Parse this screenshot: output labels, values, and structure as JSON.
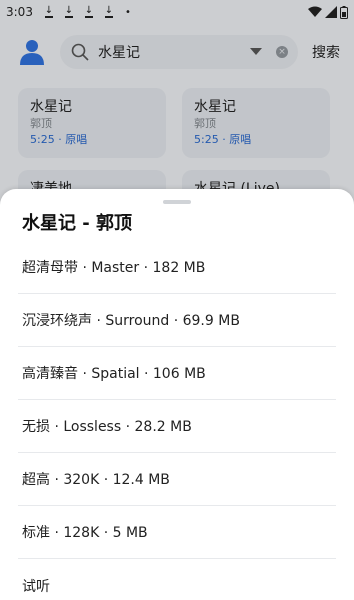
{
  "status_bar": {
    "time": "3:03",
    "download_count": 4
  },
  "header": {
    "search_value": "水星记",
    "search_button": "搜索"
  },
  "results": [
    {
      "title": "水星记",
      "artist": "郭顶",
      "duration": "5:25",
      "tag": "原唱"
    },
    {
      "title": "水星记",
      "artist": "郭顶",
      "duration": "5:25",
      "tag": "原唱"
    },
    {
      "title": "凄美地",
      "artist": "",
      "duration": "",
      "tag": ""
    },
    {
      "title": "水星记 (Live)",
      "artist": "",
      "duration": "",
      "tag": ""
    }
  ],
  "sheet": {
    "title": "水星记 - 郭顶",
    "options": [
      {
        "label": "超清母带 · Master · 182 MB"
      },
      {
        "label": "沉浸环绕声 · Surround · 69.9 MB"
      },
      {
        "label": "高清臻音 · Spatial · 106 MB"
      },
      {
        "label": "无损 · Lossless · 28.2 MB"
      },
      {
        "label": "超高 · 320K · 12.4 MB"
      },
      {
        "label": "标准 · 128K · 5 MB"
      },
      {
        "label": "试听"
      }
    ]
  },
  "colors": {
    "accent": "#2f6fd6",
    "link": "#2966c7",
    "sheet_bg": "#ffffff",
    "page_bg": "#e9ebee"
  }
}
